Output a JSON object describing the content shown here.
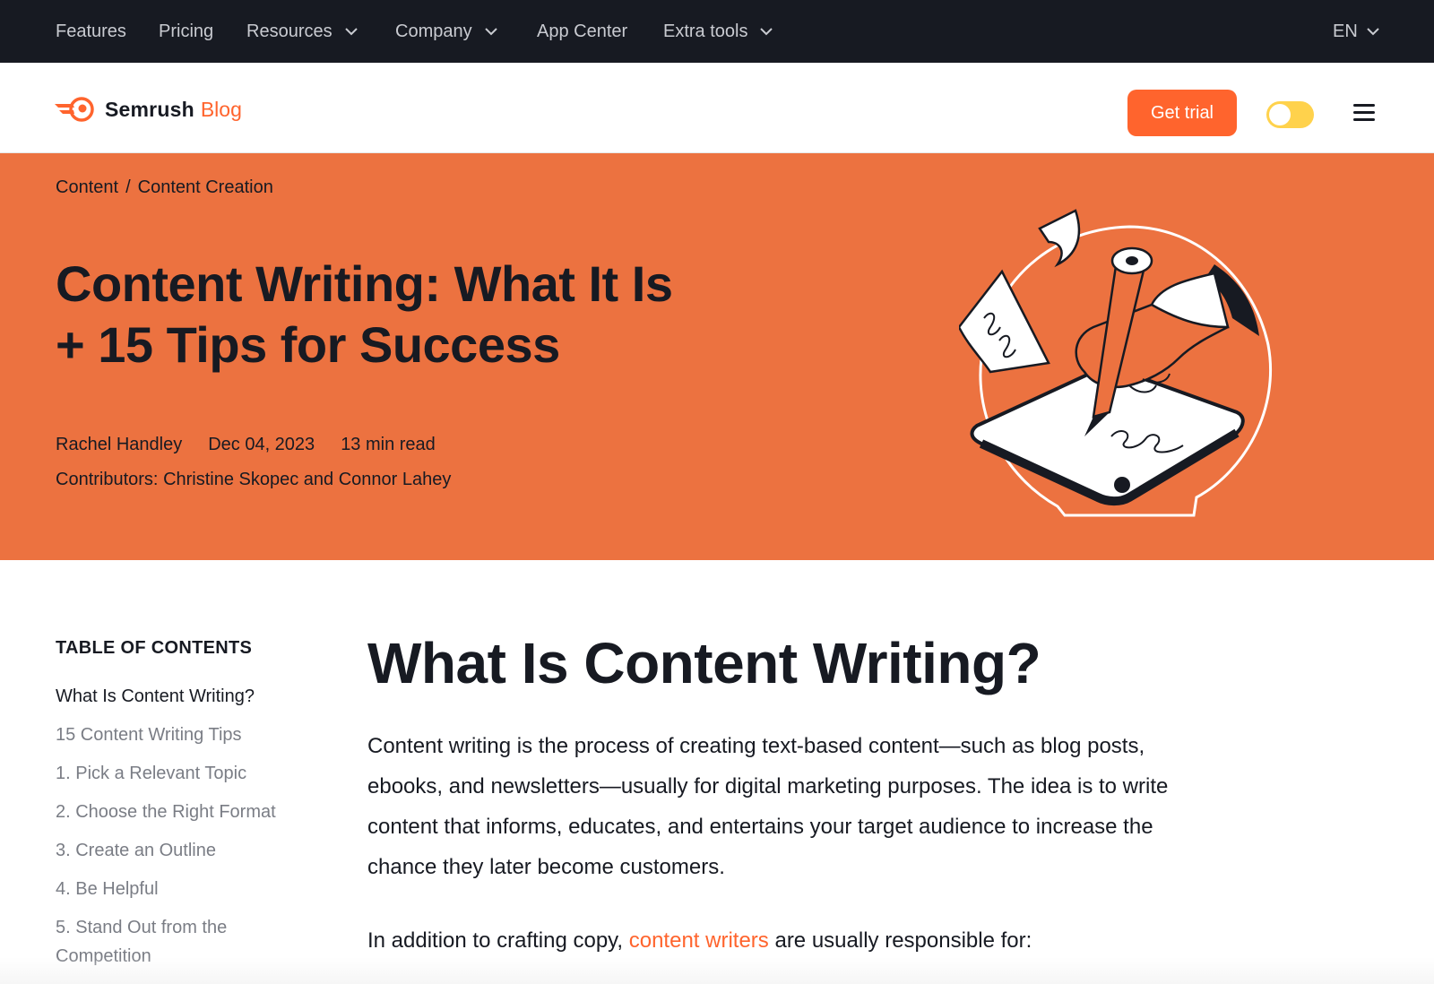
{
  "topnav": {
    "items": [
      {
        "label": "Features",
        "dropdown": false
      },
      {
        "label": "Pricing",
        "dropdown": false
      },
      {
        "label": "Resources",
        "dropdown": true
      },
      {
        "label": "Company",
        "dropdown": true
      },
      {
        "label": "App Center",
        "dropdown": false
      },
      {
        "label": "Extra tools",
        "dropdown": true
      }
    ],
    "language": "EN"
  },
  "header": {
    "logo_text": "Semrush",
    "logo_blog": "Blog",
    "cta_label": "Get trial",
    "theme_toggle_on": true
  },
  "hero": {
    "breadcrumb": [
      "Content",
      "Content Creation"
    ],
    "breadcrumb_separator": "/",
    "title": "Content Writing: What It Is + 15 Tips for Success",
    "author": "Rachel Handley",
    "date": "Dec 04, 2023",
    "read_time": "13 min read",
    "contributors_label": "Contributors:",
    "contributors": "Christine Skopec and Connor Lahey"
  },
  "toc": {
    "title": "TABLE OF CONTENTS",
    "items": [
      "What Is Content Writing?",
      "15 Content Writing Tips",
      "1. Pick a Relevant Topic",
      "2. Choose the Right Format",
      "3. Create an Outline",
      "4. Be Helpful",
      "5. Stand Out from the Competition"
    ],
    "active_index": 0
  },
  "article": {
    "heading": "What Is Content Writing?",
    "paragraph1": "Content writing is the process of creating text-based content—such as blog posts, ebooks, and newsletters—usually for digital marketing purposes. The idea is to write content that informs, educates, and entertains your target audience to increase the chance they later become customers.",
    "paragraph2_before": "In addition to crafting copy, ",
    "paragraph2_link": "content writers",
    "paragraph2_after": " are usually responsible for:"
  },
  "colors": {
    "nav_bg": "#171a22",
    "brand_orange": "#ff642d",
    "hero_bg": "#ec7240",
    "toggle_yellow": "#ffd24c",
    "muted_text": "#7a7d85"
  }
}
